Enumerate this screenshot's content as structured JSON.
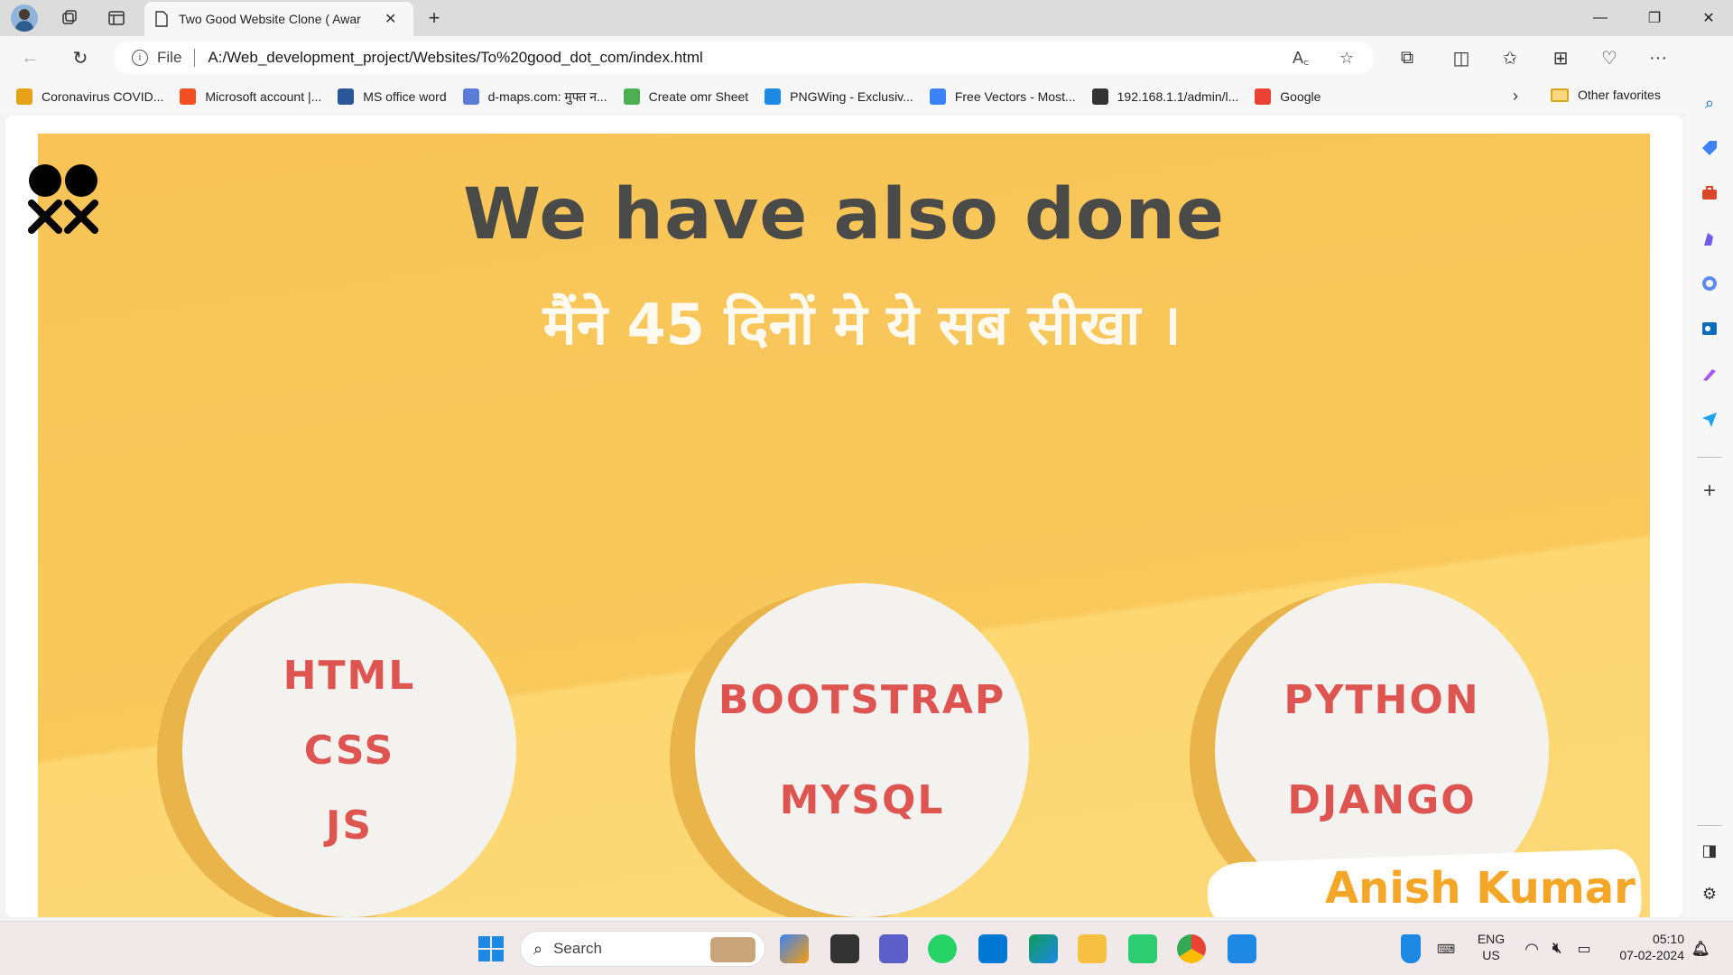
{
  "browser": {
    "tab": {
      "title": "Two Good Website Clone ( Awar"
    },
    "address": {
      "scheme_label": "File",
      "url": "A:/Web_development_project/Websites/To%20good_dot_com/index.html"
    },
    "favorites": [
      {
        "label": "Coronavirus COVID...",
        "color": "#e6a21a"
      },
      {
        "label": "Microsoft account |...",
        "color": "#f25022"
      },
      {
        "label": "MS office word",
        "color": "#2b579a"
      },
      {
        "label": "d-maps.com: मुफ्त न...",
        "color": "#5a7bd8"
      },
      {
        "label": "Create omr Sheet",
        "color": "#4caf50"
      },
      {
        "label": "PNGWing - Exclusiv...",
        "color": "#1e88e5"
      },
      {
        "label": "Free Vectors - Most...",
        "color": "#3b82f6"
      },
      {
        "label": "192.168.1.1/admin/l...",
        "color": "#333333"
      },
      {
        "label": "Google",
        "color": "#ea4335"
      }
    ],
    "other_favorites": "Other favorites"
  },
  "page": {
    "title": "We have also done",
    "subtitle": "मैंने 45 दिनों मे ये सब सीखा ।",
    "circles": [
      {
        "items": [
          "HTML",
          "CSS",
          "JS"
        ]
      },
      {
        "items": [
          "BOOTSTRAP",
          "MYSQL"
        ]
      },
      {
        "items": [
          "PYTHON",
          "DJANGO"
        ]
      }
    ],
    "signature": "Anish Kumar"
  },
  "taskbar": {
    "search_label": "Search",
    "language": "ENG",
    "region": "US",
    "time": "05:10",
    "date": "07-02-2024"
  }
}
